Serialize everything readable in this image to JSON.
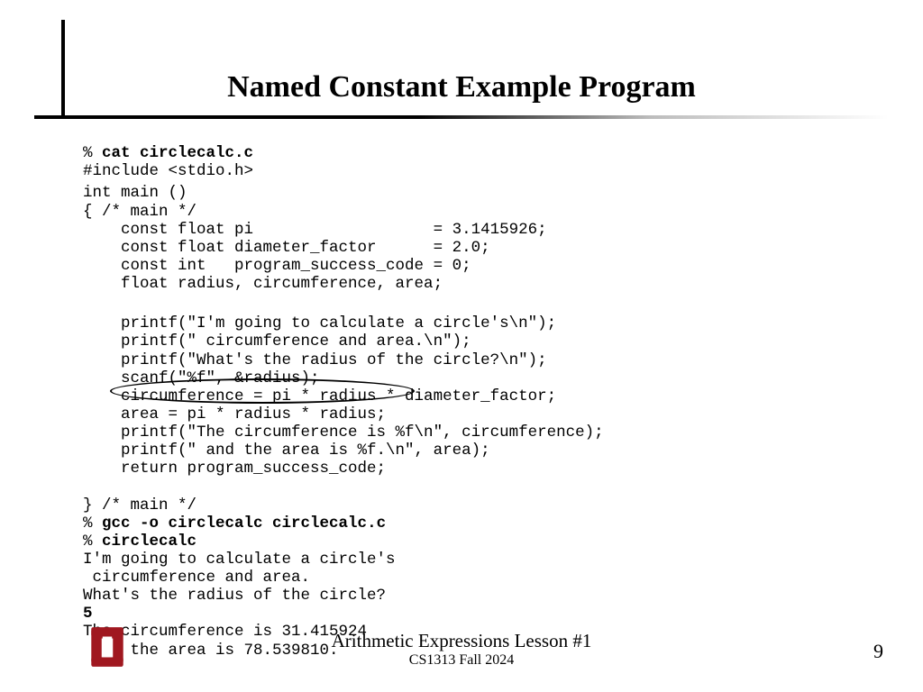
{
  "title": "Named Constant Example Program",
  "code": {
    "l01a": "% ",
    "l01b": "cat circlecalc.c",
    "l02": "#include <stdio.h>",
    "l03": "int main ()",
    "l04": "{ /* main */",
    "l05": "    const float pi                   = 3.1415926;",
    "l06": "    const float diameter_factor      = 2.0;",
    "l07": "    const int   program_success_code = 0;",
    "l08": "    float radius, circumference, area;",
    "l09": "    printf(\"I'm going to calculate a circle's\\n\");",
    "l10": "    printf(\" circumference and area.\\n\");",
    "l11": "    printf(\"What's the radius of the circle?\\n\");",
    "l12": "    scanf(\"%f\", &radius);",
    "l13": "    circumference = pi * radius * diameter_factor;",
    "l14": "    area = pi * radius * radius;",
    "l15": "    printf(\"The circumference is %f\\n\", circumference);",
    "l16": "    printf(\" and the area is %f.\\n\", area);",
    "l17": "    return program_success_code;",
    "l18": "} /* main */",
    "l19a": "% ",
    "l19b": "gcc -o circlecalc circlecalc.c",
    "l20a": "% ",
    "l20b": "circlecalc",
    "l21": "I'm going to calculate a circle's",
    "l22": " circumference and area.",
    "l23": "What's the radius of the circle?",
    "l24": "5",
    "l25": "The circumference is 31.415924",
    "l26": " and the area is 78.539810."
  },
  "footer": {
    "line1": "Arithmetic Expressions Lesson #1",
    "line2": "CS1313 Fall 2024"
  },
  "page_number": "9",
  "logo_name": "ou-logo"
}
